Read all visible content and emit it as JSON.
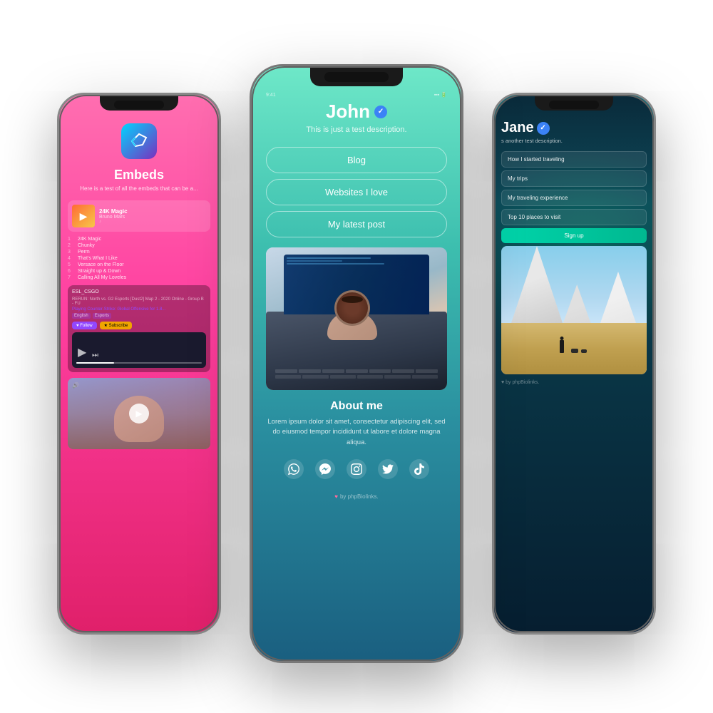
{
  "phones": {
    "left": {
      "title": "Embeds",
      "subtitle": "Here is a test of all the embeds that can be a...",
      "logo_icon": "◈",
      "music": {
        "song": "24K Magic",
        "artist": "Bruno Mars",
        "tracks": [
          {
            "num": "1",
            "name": "24K Magic"
          },
          {
            "num": "2",
            "name": "Chunky"
          },
          {
            "num": "3",
            "name": "Perm"
          },
          {
            "num": "4",
            "name": "That's What I Like"
          },
          {
            "num": "5",
            "name": "Versace on the Floor"
          },
          {
            "num": "6",
            "name": "Straight up & Down"
          },
          {
            "num": "7",
            "name": "Calling All My Loveles"
          }
        ]
      },
      "twitch": {
        "title": "ESL_CSGO",
        "subtitle": "RERUN: North vs. G2 Esports [Dust2] Map 2 - 2020 Online - Group B - FU",
        "game": "Playing Counter-Strike: Global Offensive for 1.8...",
        "tags": [
          "English",
          "Esports"
        ],
        "follow_label": "Follow",
        "subscribe_label": "Subscribe"
      }
    },
    "center": {
      "name": "John",
      "description": "This is just a test description.",
      "buttons": [
        {
          "label": "Blog"
        },
        {
          "label": "Websites I love"
        },
        {
          "label": "My latest post"
        }
      ],
      "about_title": "About me",
      "about_text": "Lorem ipsum dolor sit amet, consectetur adipiscing elit, sed do eiusmod tempor incididunt ut labore et dolore magna aliqua.",
      "social_icons": [
        "📱",
        "💬",
        "📸",
        "🐦",
        "♪"
      ],
      "footer": "♥ by phpBiolinks."
    },
    "right": {
      "name": "Jane",
      "description": "s another test description.",
      "links": [
        {
          "label": "w I started traveling"
        },
        {
          "label": "My trips"
        },
        {
          "label": "t traveling experience"
        },
        {
          "label": "p 10 places to visit"
        }
      ],
      "signup_label": "Sign up",
      "footer": "♥ by phpBiolinks."
    }
  }
}
